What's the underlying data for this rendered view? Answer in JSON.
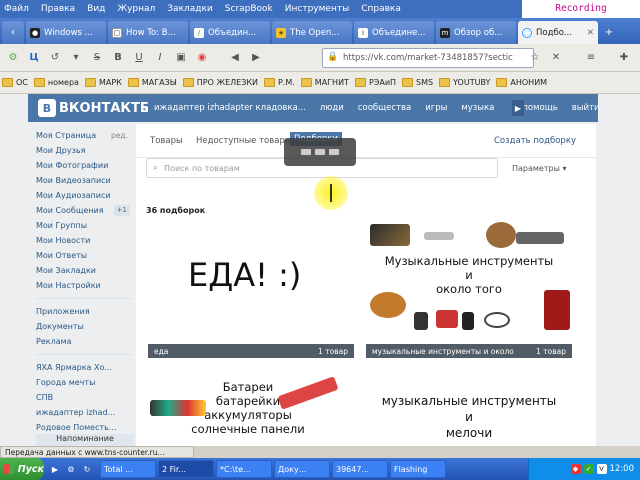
{
  "menubar": {
    "items": [
      "Файл",
      "Правка",
      "Вид",
      "Журнал",
      "Закладки",
      "ScrapBook",
      "Инструменты",
      "Справка"
    ],
    "recording": "Recording 12:00:36:875"
  },
  "tabs": [
    {
      "label": "Windows ...",
      "icon": "globe-icon"
    },
    {
      "label": "How To: B...",
      "icon": "page-icon"
    },
    {
      "label": "Объедин...",
      "icon": "flag-icon"
    },
    {
      "label": "The Open...",
      "icon": "star-icon"
    },
    {
      "label": "Объедине...",
      "icon": "info-icon"
    },
    {
      "label": "Обзор об...",
      "icon": "m-icon"
    },
    {
      "label": "Подбо...",
      "icon": "loading-icon",
      "active": true
    }
  ],
  "nav": {
    "url": "https://vk.com/market-73481857?sectic"
  },
  "bookmarks": [
    "ОС",
    "номера",
    "МАРК",
    "МАГАЗЫ",
    "ПРО ЖЕЛЕЗКИ",
    "Р.М.",
    "МАГНИТ",
    "РЭАиП",
    "SMS",
    "YOUTUBY",
    "АНОНИМ"
  ],
  "vk": {
    "logo": "ВКОНТАКТЕ",
    "nav": [
      "ижадаптер izhadapter кладовка...",
      "люди",
      "сообщества",
      "игры",
      "музыка",
      "помощь",
      "выйти"
    ],
    "left_menu": [
      {
        "label": "Моя Страница",
        "extra": "ред."
      },
      {
        "label": "Мои Друзья"
      },
      {
        "label": "Мои Фотографии"
      },
      {
        "label": "Мои Видеозаписи"
      },
      {
        "label": "Мои Аудиозаписи"
      },
      {
        "label": "Мои Сообщения",
        "count": "+1"
      },
      {
        "label": "Мои Группы"
      },
      {
        "label": "Мои Новости"
      },
      {
        "label": "Мои Ответы"
      },
      {
        "label": "Мои Закладки"
      },
      {
        "label": "Мои Настройки"
      }
    ],
    "left_menu2": [
      "Приложения",
      "Документы",
      "Реклама"
    ],
    "left_menu3": [
      "ЯХА Ярмарка Хо...",
      "Города мечты",
      "СПВ",
      "ижадаптер izhad...",
      "Родовое Поместь..."
    ],
    "left_note": "Напоминание",
    "tabs": [
      "Товары",
      "Недоступные товары",
      "Подборки"
    ],
    "create": "Создать подборку",
    "search_placeholder": "Поиск по товарам",
    "params": "Параметры",
    "count_label": "36 подборок",
    "cards": [
      {
        "title": "еда",
        "count": "1 товар",
        "caption": "ЕДА! :)"
      },
      {
        "title": "музыкальные инструменты и около",
        "count": "1 товар",
        "caption1": "Музыкальные инструменты",
        "caption2": "и",
        "caption3": "около того"
      },
      {
        "caption1": "Батареи",
        "caption2": "батарейки",
        "caption3": "аккумуляторы",
        "caption4": "солнечные панели"
      },
      {
        "caption1": "музыкальные инструменты",
        "caption2": "и",
        "caption3": "мелочи"
      }
    ]
  },
  "status": "Передача данных с www.tns-counter.ru...",
  "taskbar": {
    "start": "Пуск",
    "buttons": [
      "Total ...",
      "2 Fir...",
      "*C:\\te...",
      "Доку...",
      "39647...",
      "Flashing"
    ],
    "clock": "12:00"
  }
}
